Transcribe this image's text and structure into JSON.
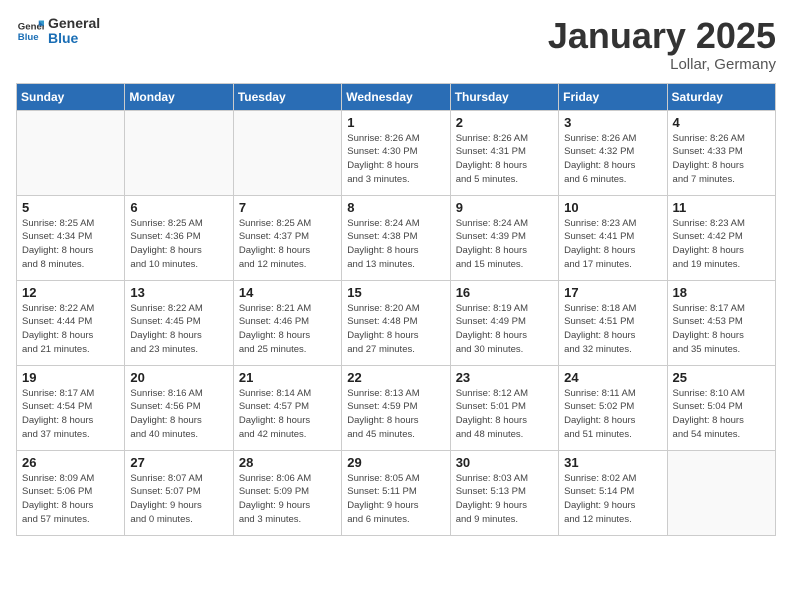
{
  "header": {
    "logo_general": "General",
    "logo_blue": "Blue",
    "month_title": "January 2025",
    "location": "Lollar, Germany"
  },
  "weekdays": [
    "Sunday",
    "Monday",
    "Tuesday",
    "Wednesday",
    "Thursday",
    "Friday",
    "Saturday"
  ],
  "weeks": [
    [
      {
        "day": "",
        "info": ""
      },
      {
        "day": "",
        "info": ""
      },
      {
        "day": "",
        "info": ""
      },
      {
        "day": "1",
        "info": "Sunrise: 8:26 AM\nSunset: 4:30 PM\nDaylight: 8 hours\nand 3 minutes."
      },
      {
        "day": "2",
        "info": "Sunrise: 8:26 AM\nSunset: 4:31 PM\nDaylight: 8 hours\nand 5 minutes."
      },
      {
        "day": "3",
        "info": "Sunrise: 8:26 AM\nSunset: 4:32 PM\nDaylight: 8 hours\nand 6 minutes."
      },
      {
        "day": "4",
        "info": "Sunrise: 8:26 AM\nSunset: 4:33 PM\nDaylight: 8 hours\nand 7 minutes."
      }
    ],
    [
      {
        "day": "5",
        "info": "Sunrise: 8:25 AM\nSunset: 4:34 PM\nDaylight: 8 hours\nand 8 minutes."
      },
      {
        "day": "6",
        "info": "Sunrise: 8:25 AM\nSunset: 4:36 PM\nDaylight: 8 hours\nand 10 minutes."
      },
      {
        "day": "7",
        "info": "Sunrise: 8:25 AM\nSunset: 4:37 PM\nDaylight: 8 hours\nand 12 minutes."
      },
      {
        "day": "8",
        "info": "Sunrise: 8:24 AM\nSunset: 4:38 PM\nDaylight: 8 hours\nand 13 minutes."
      },
      {
        "day": "9",
        "info": "Sunrise: 8:24 AM\nSunset: 4:39 PM\nDaylight: 8 hours\nand 15 minutes."
      },
      {
        "day": "10",
        "info": "Sunrise: 8:23 AM\nSunset: 4:41 PM\nDaylight: 8 hours\nand 17 minutes."
      },
      {
        "day": "11",
        "info": "Sunrise: 8:23 AM\nSunset: 4:42 PM\nDaylight: 8 hours\nand 19 minutes."
      }
    ],
    [
      {
        "day": "12",
        "info": "Sunrise: 8:22 AM\nSunset: 4:44 PM\nDaylight: 8 hours\nand 21 minutes."
      },
      {
        "day": "13",
        "info": "Sunrise: 8:22 AM\nSunset: 4:45 PM\nDaylight: 8 hours\nand 23 minutes."
      },
      {
        "day": "14",
        "info": "Sunrise: 8:21 AM\nSunset: 4:46 PM\nDaylight: 8 hours\nand 25 minutes."
      },
      {
        "day": "15",
        "info": "Sunrise: 8:20 AM\nSunset: 4:48 PM\nDaylight: 8 hours\nand 27 minutes."
      },
      {
        "day": "16",
        "info": "Sunrise: 8:19 AM\nSunset: 4:49 PM\nDaylight: 8 hours\nand 30 minutes."
      },
      {
        "day": "17",
        "info": "Sunrise: 8:18 AM\nSunset: 4:51 PM\nDaylight: 8 hours\nand 32 minutes."
      },
      {
        "day": "18",
        "info": "Sunrise: 8:17 AM\nSunset: 4:53 PM\nDaylight: 8 hours\nand 35 minutes."
      }
    ],
    [
      {
        "day": "19",
        "info": "Sunrise: 8:17 AM\nSunset: 4:54 PM\nDaylight: 8 hours\nand 37 minutes."
      },
      {
        "day": "20",
        "info": "Sunrise: 8:16 AM\nSunset: 4:56 PM\nDaylight: 8 hours\nand 40 minutes."
      },
      {
        "day": "21",
        "info": "Sunrise: 8:14 AM\nSunset: 4:57 PM\nDaylight: 8 hours\nand 42 minutes."
      },
      {
        "day": "22",
        "info": "Sunrise: 8:13 AM\nSunset: 4:59 PM\nDaylight: 8 hours\nand 45 minutes."
      },
      {
        "day": "23",
        "info": "Sunrise: 8:12 AM\nSunset: 5:01 PM\nDaylight: 8 hours\nand 48 minutes."
      },
      {
        "day": "24",
        "info": "Sunrise: 8:11 AM\nSunset: 5:02 PM\nDaylight: 8 hours\nand 51 minutes."
      },
      {
        "day": "25",
        "info": "Sunrise: 8:10 AM\nSunset: 5:04 PM\nDaylight: 8 hours\nand 54 minutes."
      }
    ],
    [
      {
        "day": "26",
        "info": "Sunrise: 8:09 AM\nSunset: 5:06 PM\nDaylight: 8 hours\nand 57 minutes."
      },
      {
        "day": "27",
        "info": "Sunrise: 8:07 AM\nSunset: 5:07 PM\nDaylight: 9 hours\nand 0 minutes."
      },
      {
        "day": "28",
        "info": "Sunrise: 8:06 AM\nSunset: 5:09 PM\nDaylight: 9 hours\nand 3 minutes."
      },
      {
        "day": "29",
        "info": "Sunrise: 8:05 AM\nSunset: 5:11 PM\nDaylight: 9 hours\nand 6 minutes."
      },
      {
        "day": "30",
        "info": "Sunrise: 8:03 AM\nSunset: 5:13 PM\nDaylight: 9 hours\nand 9 minutes."
      },
      {
        "day": "31",
        "info": "Sunrise: 8:02 AM\nSunset: 5:14 PM\nDaylight: 9 hours\nand 12 minutes."
      },
      {
        "day": "",
        "info": ""
      }
    ]
  ]
}
